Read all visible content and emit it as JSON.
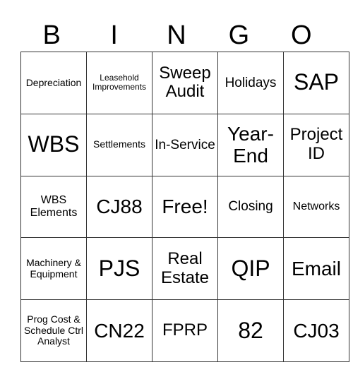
{
  "header": [
    "B",
    "I",
    "N",
    "G",
    "O"
  ],
  "rows": [
    [
      "Depreciation",
      "Leasehold Improvements",
      "Sweep Audit",
      "Holidays",
      "SAP"
    ],
    [
      "WBS",
      "Settlements",
      "In-Service",
      "Year-End",
      "Project ID"
    ],
    [
      "WBS Elements",
      "CJ88",
      "Free!",
      "Closing",
      "Networks"
    ],
    [
      "Machinery & Equipment",
      "PJS",
      "Real Estate",
      "QIP",
      "Email"
    ],
    [
      "Prog Cost & Schedule Ctrl Analyst",
      "CN22",
      "FPRP",
      "82",
      "CJ03"
    ]
  ]
}
